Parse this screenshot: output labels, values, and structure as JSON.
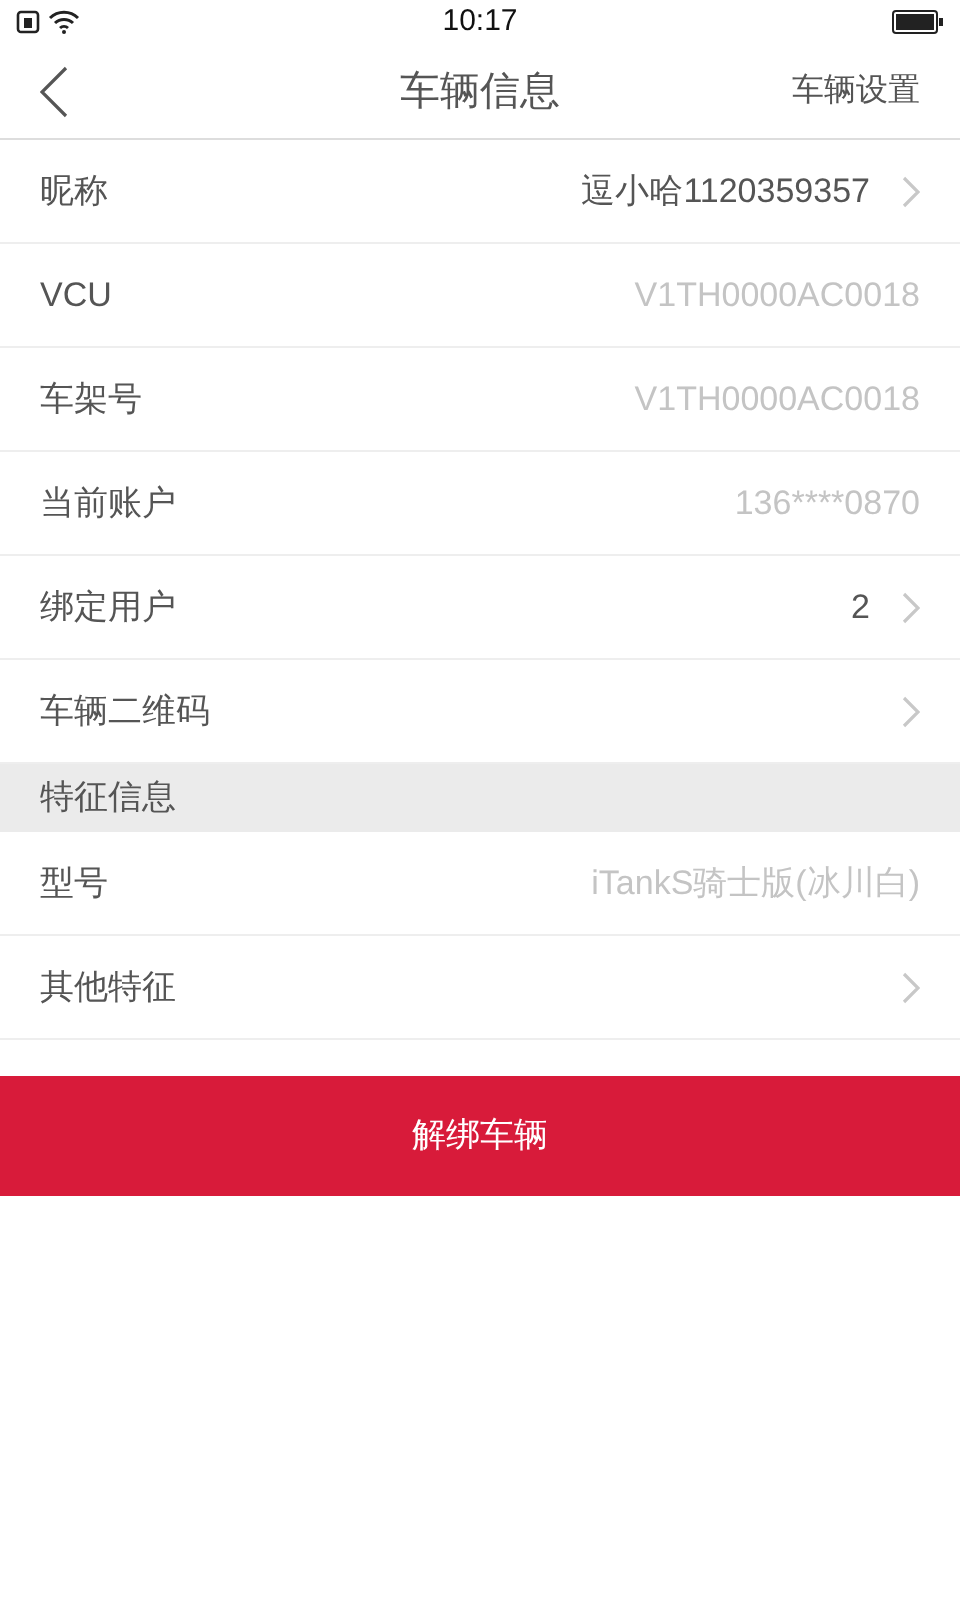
{
  "status_bar": {
    "time": "10:17"
  },
  "header": {
    "title": "车辆信息",
    "action": "车辆设置"
  },
  "sections": [
    {
      "rows": [
        {
          "label": "昵称",
          "value": "逗小哈1120359357",
          "kind": "link"
        },
        {
          "label": "VCU",
          "value": "V1TH0000AC0018",
          "kind": "info"
        },
        {
          "label": "车架号",
          "value": "V1TH0000AC0018",
          "kind": "info"
        },
        {
          "label": "当前账户",
          "value": "136****0870",
          "kind": "info"
        },
        {
          "label": "绑定用户",
          "value": "2",
          "kind": "link"
        },
        {
          "label": "车辆二维码",
          "kind": "link"
        }
      ]
    },
    {
      "title": "特征信息",
      "rows": [
        {
          "label": "型号",
          "value": "iTankS骑士版(冰川白)",
          "kind": "info"
        },
        {
          "label": "其他特征",
          "kind": "link"
        }
      ]
    }
  ],
  "unbind_button": "解绑车辆"
}
